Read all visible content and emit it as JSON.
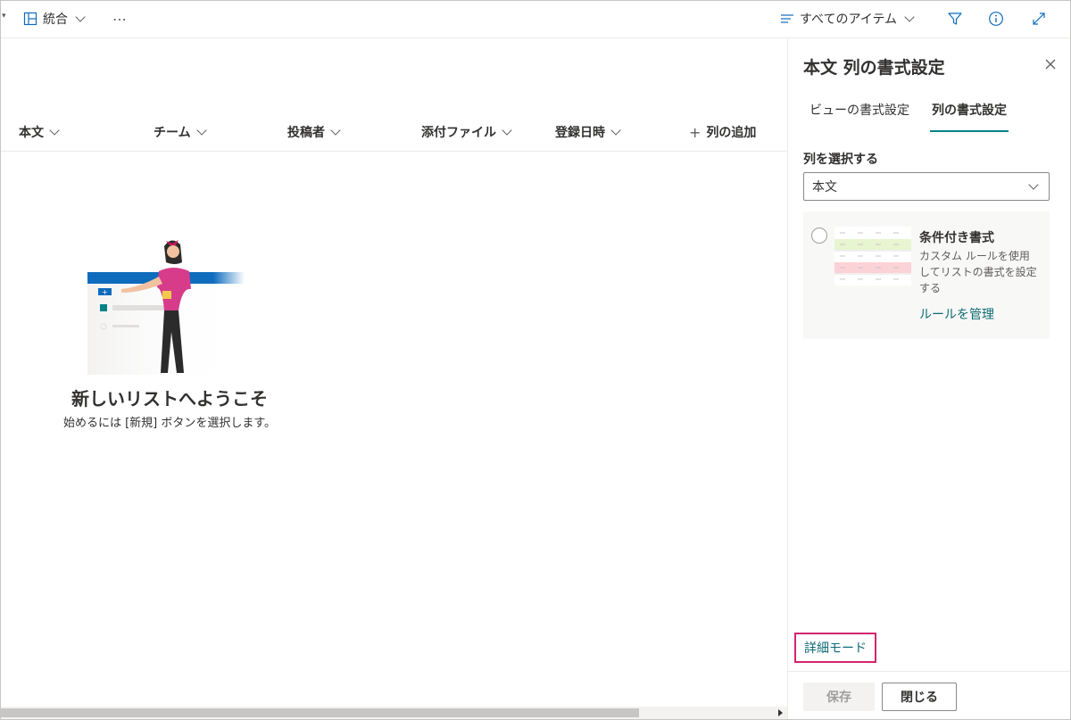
{
  "toolbar": {
    "view_name": "統合",
    "more": "⋯",
    "all_items": "すべてのアイテム"
  },
  "columns": [
    "本文",
    "チーム",
    "投稿者",
    "添付ファイル",
    "登録日時"
  ],
  "add_column": "列の追加",
  "empty_state": {
    "title": "新しいリストへようこそ",
    "subtitle": "始めるには [新規] ボタンを選択します。"
  },
  "panel": {
    "title": "本文 列の書式設定",
    "tabs": [
      "ビューの書式設定",
      "列の書式設定"
    ],
    "active_tab": "列の書式設定",
    "select_label": "列を選択する",
    "select_value": "本文",
    "option": {
      "title": "条件付き書式",
      "description": "カスタム ルールを使用してリストの書式を設定する",
      "link": "ルールを管理"
    },
    "advanced_mode": "詳細モード",
    "save": "保存",
    "close": "閉じる"
  },
  "colors": {
    "accent": "#038387",
    "link": "#0f6a75",
    "highlight_box": "#d3246e"
  }
}
